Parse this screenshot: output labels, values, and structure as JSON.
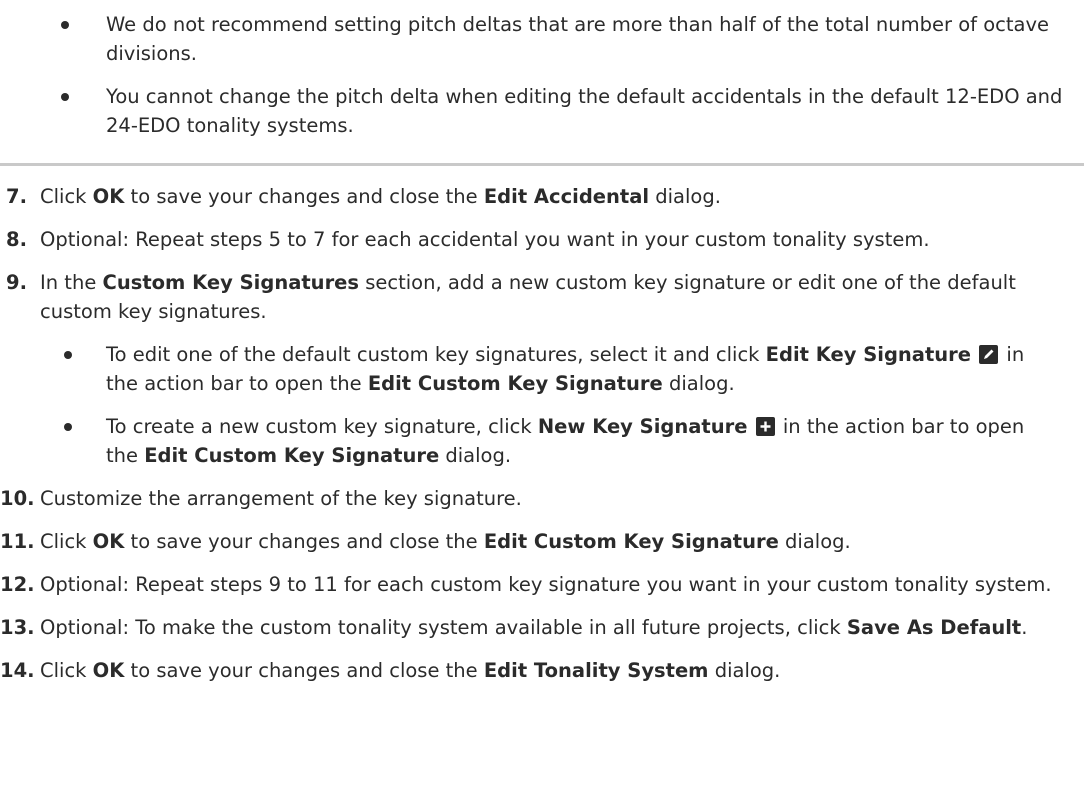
{
  "top_bullets": [
    "We do not recommend setting pitch deltas that are more than half of the total number of octave divisions.",
    "You cannot change the pitch delta when editing the default accidentals in the default 12-EDO and 24-EDO tonality systems."
  ],
  "steps": {
    "s7": {
      "num": "7.",
      "t1": "Click ",
      "b1": "OK",
      "t2": " to save your changes and close the ",
      "b2": "Edit Accidental",
      "t3": " dialog."
    },
    "s8": {
      "num": "8.",
      "t1": "Optional: Repeat steps 5 to 7 for each accidental you want in your custom tonality system."
    },
    "s9": {
      "num": "9.",
      "t1": "In the ",
      "b1": "Custom Key Signatures",
      "t2": " section, add a new custom key signature or edit one of the default custom key signatures.",
      "sub1": {
        "t1": "To edit one of the default custom key signatures, select it and click ",
        "b1": "Edit Key Signature",
        "t2": " in the action bar to open the ",
        "b2": "Edit Custom Key Signature",
        "t3": " dialog.",
        "icon": "pencil-icon"
      },
      "sub2": {
        "t1": "To create a new custom key signature, click ",
        "b1": "New Key Signature",
        "t2": " in the action bar to open the ",
        "b2": "Edit Custom Key Signature",
        "t3": " dialog.",
        "icon": "plus-icon"
      }
    },
    "s10": {
      "num": "10.",
      "t1": "Customize the arrangement of the key signature."
    },
    "s11": {
      "num": "11.",
      "t1": "Click ",
      "b1": "OK",
      "t2": " to save your changes and close the ",
      "b2": "Edit Custom Key Signature",
      "t3": " dialog."
    },
    "s12": {
      "num": "12.",
      "t1": "Optional: Repeat steps 9 to 11 for each custom key signature you want in your custom tonality system."
    },
    "s13": {
      "num": "13.",
      "t1": "Optional: To make the custom tonality system available in all future projects, click ",
      "b1": "Save As Default",
      "t2": "."
    },
    "s14": {
      "num": "14.",
      "t1": "Click ",
      "b1": "OK",
      "t2": " to save your changes and close the ",
      "b2": "Edit Tonality System",
      "t3": " dialog."
    }
  }
}
